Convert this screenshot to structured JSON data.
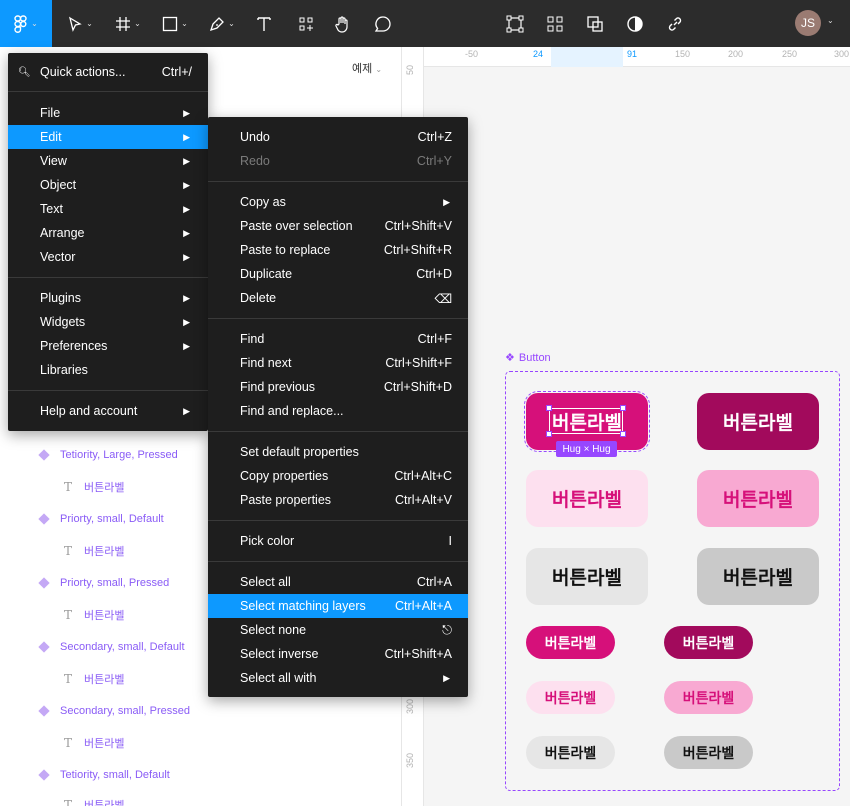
{
  "toolbar": {
    "avatar_initials": "JS"
  },
  "layers_panel": {
    "page_selector": "예제",
    "rows": [
      {
        "type": "component",
        "label": "Tetiority, Large, Pressed"
      },
      {
        "type": "text",
        "label": "버튼라벨"
      },
      {
        "type": "component",
        "label": "Priorty, small, Default"
      },
      {
        "type": "text",
        "label": "버튼라벨"
      },
      {
        "type": "component",
        "label": "Priorty, small, Pressed"
      },
      {
        "type": "text",
        "label": "버튼라벨"
      },
      {
        "type": "component",
        "label": "Secondary, small, Default"
      },
      {
        "type": "text",
        "label": "버튼라벨"
      },
      {
        "type": "component",
        "label": "Secondary, small, Pressed"
      },
      {
        "type": "text",
        "label": "버튼라벨"
      },
      {
        "type": "component",
        "label": "Tetiority, small, Default"
      },
      {
        "type": "text",
        "label": "버튼라벨"
      }
    ]
  },
  "ruler": {
    "top": [
      "-50",
      "24",
      "91",
      "150",
      "200",
      "250",
      "300"
    ],
    "left": [
      "300",
      "350"
    ],
    "left_top": "50"
  },
  "canvas": {
    "component_label": "Button",
    "hug_label": "Hug × Hug",
    "button_text": "버튼라벨",
    "colors": {
      "primary_default": "#d6107a",
      "primary_pressed": "#a20a5c",
      "secondary_default": "#fde0ef",
      "secondary_pressed": "#f8a9d2",
      "tertiary_default": "#e6e6e6",
      "tertiary_pressed": "#c9c9c9",
      "selection": "#9747ff"
    }
  },
  "main_menu": {
    "quick_actions": {
      "label": "Quick actions...",
      "shortcut": "Ctrl+/"
    },
    "items": [
      {
        "label": "File"
      },
      {
        "label": "Edit"
      },
      {
        "label": "View"
      },
      {
        "label": "Object"
      },
      {
        "label": "Text"
      },
      {
        "label": "Arrange"
      },
      {
        "label": "Vector"
      },
      {
        "label": "Plugins"
      },
      {
        "label": "Widgets"
      },
      {
        "label": "Preferences"
      },
      {
        "label": "Libraries"
      },
      {
        "label": "Help and account"
      }
    ]
  },
  "edit_menu": {
    "items": [
      {
        "label": "Undo",
        "shortcut": "Ctrl+Z"
      },
      {
        "label": "Redo",
        "shortcut": "Ctrl+Y"
      },
      {
        "label": "Copy as",
        "shortcut": ""
      },
      {
        "label": "Paste over selection",
        "shortcut": "Ctrl+Shift+V"
      },
      {
        "label": "Paste to replace",
        "shortcut": "Ctrl+Shift+R"
      },
      {
        "label": "Duplicate",
        "shortcut": "Ctrl+D"
      },
      {
        "label": "Delete",
        "shortcut": "⌫"
      },
      {
        "label": "Find",
        "shortcut": "Ctrl+F"
      },
      {
        "label": "Find next",
        "shortcut": "Ctrl+Shift+F"
      },
      {
        "label": "Find previous",
        "shortcut": "Ctrl+Shift+D"
      },
      {
        "label": "Find and replace...",
        "shortcut": ""
      },
      {
        "label": "Set default properties",
        "shortcut": ""
      },
      {
        "label": "Copy properties",
        "shortcut": "Ctrl+Alt+C"
      },
      {
        "label": "Paste properties",
        "shortcut": "Ctrl+Alt+V"
      },
      {
        "label": "Pick color",
        "shortcut": "I"
      },
      {
        "label": "Select all",
        "shortcut": "Ctrl+A"
      },
      {
        "label": "Select matching layers",
        "shortcut": "Ctrl+Alt+A"
      },
      {
        "label": "Select none",
        "shortcut": "⎋"
      },
      {
        "label": "Select inverse",
        "shortcut": "Ctrl+Shift+A"
      },
      {
        "label": "Select all with",
        "shortcut": ""
      }
    ]
  }
}
